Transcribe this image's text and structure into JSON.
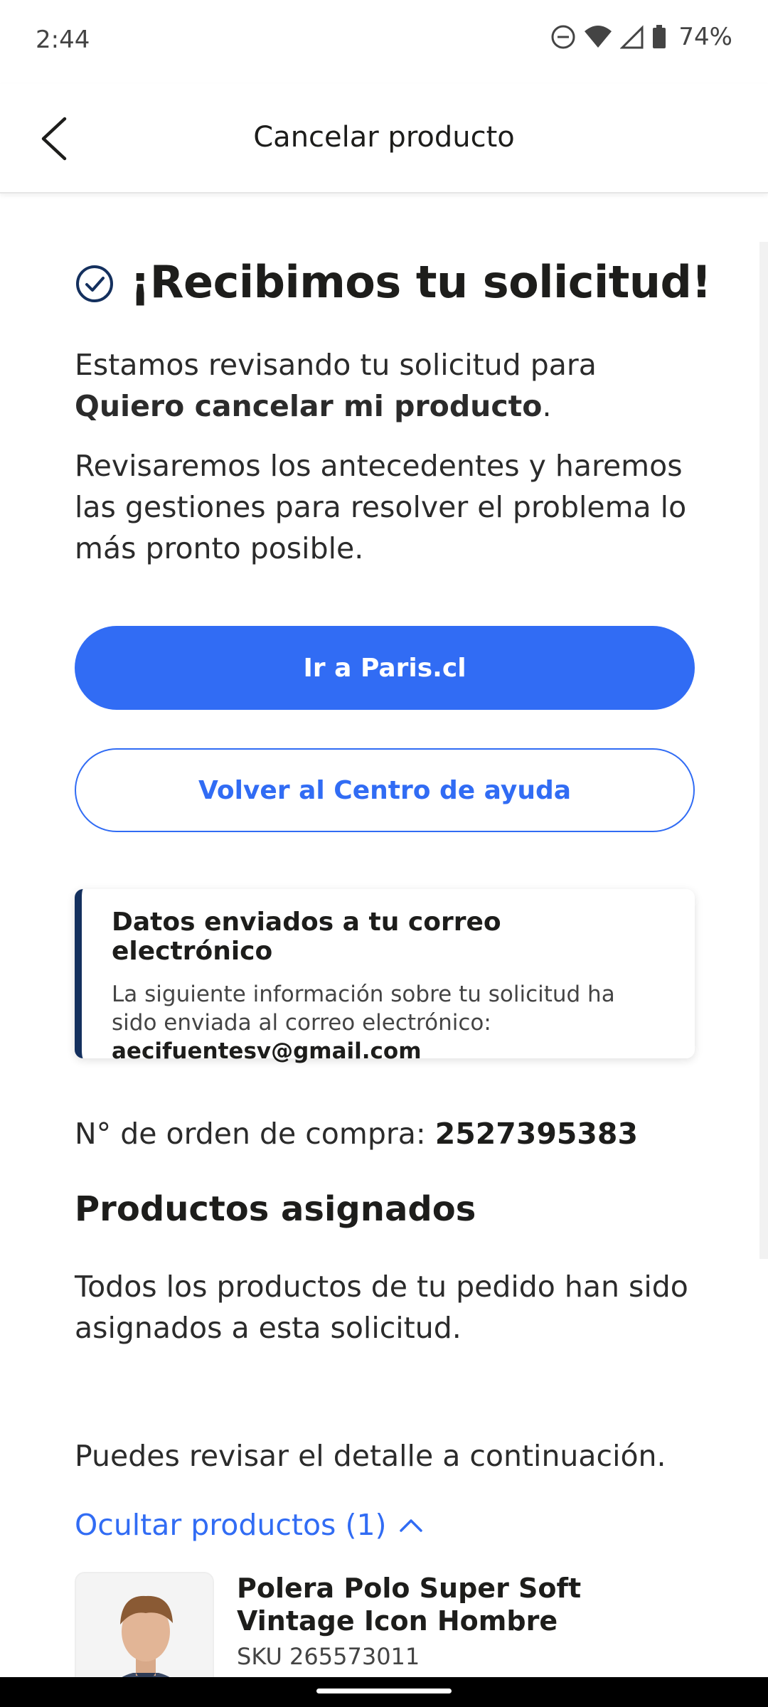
{
  "status_bar": {
    "time": "2:44",
    "battery": "74%"
  },
  "header": {
    "title": "Cancelar producto"
  },
  "confirmation": {
    "headline": "¡Recibimos tu solicitud!",
    "intro": "Estamos revisando tu solicitud para",
    "request_type": "Quiero cancelar mi producto",
    "intro_end": ".",
    "details": "Revisaremos los antecedentes y haremos las gestiones para resolver el problema lo más pronto posible."
  },
  "buttons": {
    "primary_label": "Ir a Paris.cl",
    "secondary_label": "Volver al Centro de ayuda"
  },
  "email_card": {
    "title": "Datos enviados a tu correo electrónico",
    "text": "La siguiente información sobre tu solicitud ha sido enviada al correo electrónico:",
    "email": "aecifuentesv@gmail.com"
  },
  "order": {
    "label": "N° de orden de compra: ",
    "number": "2527395383"
  },
  "products": {
    "title": "Productos asignados",
    "note": "Todos los productos de tu pedido han sido asignados a esta solicitud.",
    "detail_note": "Puedes revisar el detalle a continuación.",
    "toggle_label": "Ocultar productos (1)",
    "items": [
      {
        "name": "Polera Polo Super Soft Vintage Icon Hombre",
        "sku": "SKU 265573011"
      }
    ]
  },
  "colors": {
    "accent": "#316cf4",
    "card_border": "#14305e",
    "text": "#1d1d1b"
  }
}
